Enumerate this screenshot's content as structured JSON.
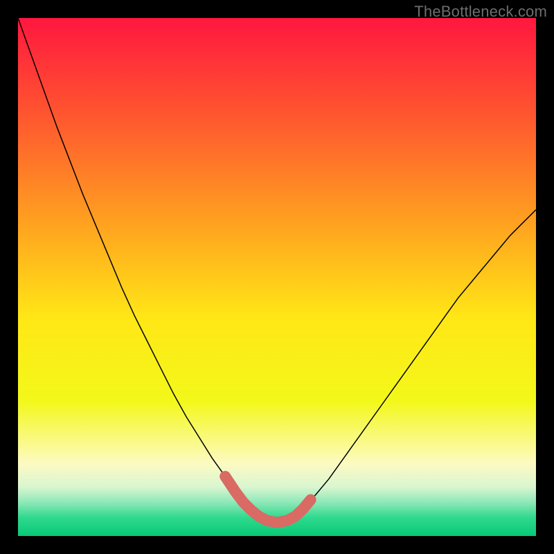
{
  "watermark": "TheBottleneck.com",
  "chart_data": {
    "type": "line",
    "title": "",
    "xlabel": "",
    "ylabel": "",
    "xlim": [
      0,
      100
    ],
    "ylim": [
      0,
      100
    ],
    "background_gradient": {
      "stops": [
        {
          "offset": 0.0,
          "color": "#ff173f"
        },
        {
          "offset": 0.2,
          "color": "#ff5a2e"
        },
        {
          "offset": 0.4,
          "color": "#ffa31f"
        },
        {
          "offset": 0.58,
          "color": "#ffe716"
        },
        {
          "offset": 0.74,
          "color": "#f3f81a"
        },
        {
          "offset": 0.86,
          "color": "#fdfac2"
        },
        {
          "offset": 0.905,
          "color": "#d9f6d0"
        },
        {
          "offset": 0.935,
          "color": "#8ee8b8"
        },
        {
          "offset": 0.965,
          "color": "#2ed98d"
        },
        {
          "offset": 1.0,
          "color": "#08c977"
        }
      ]
    },
    "series": [
      {
        "name": "bottleneck-curve",
        "stroke": "#000000",
        "stroke_width": 1.5,
        "x": [
          0.0,
          2.5,
          5.0,
          7.5,
          10.0,
          12.5,
          15.0,
          17.5,
          20.0,
          22.5,
          25.0,
          27.5,
          30.0,
          32.5,
          35.0,
          37.5,
          40.0,
          42.0,
          43.5,
          45.0,
          46.5,
          48.0,
          50.0,
          52.0,
          53.5,
          55.0,
          57.5,
          60.0,
          62.5,
          65.0,
          67.5,
          70.0,
          72.5,
          75.0,
          77.5,
          80.0,
          82.5,
          85.0,
          87.5,
          90.0,
          92.5,
          95.0,
          97.5,
          100.0
        ],
        "values": [
          100.0,
          93.0,
          86.0,
          79.0,
          72.5,
          66.0,
          60.0,
          54.0,
          48.0,
          42.5,
          37.5,
          32.5,
          27.5,
          23.0,
          19.0,
          15.0,
          11.5,
          8.5,
          6.5,
          5.0,
          3.8,
          3.0,
          2.6,
          3.0,
          3.8,
          5.2,
          8.0,
          11.0,
          14.5,
          18.0,
          21.5,
          25.0,
          28.5,
          32.0,
          35.5,
          39.0,
          42.5,
          46.0,
          49.0,
          52.0,
          55.0,
          58.0,
          60.5,
          63.0
        ]
      },
      {
        "name": "optimal-zone-marker",
        "stroke": "#d96a64",
        "stroke_width": 16,
        "linecap": "round",
        "x": [
          40.0,
          42.0,
          43.5,
          45.0,
          46.5,
          48.0,
          50.0,
          52.0,
          53.5,
          55.0,
          56.5
        ],
        "values": [
          11.5,
          8.5,
          6.5,
          5.0,
          3.8,
          3.0,
          2.6,
          3.0,
          3.8,
          5.2,
          7.0
        ]
      }
    ]
  }
}
